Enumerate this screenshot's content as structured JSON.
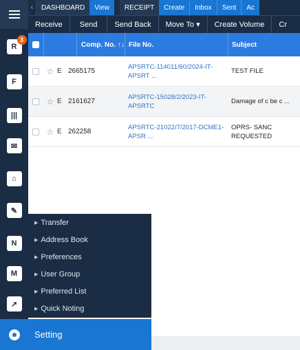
{
  "rail": {
    "badge_count": "3",
    "icons": [
      "hamburger-icon",
      "receipt-icon",
      "file-icon",
      "barcode-icon",
      "mail-tray-icon",
      "dispatch-icon",
      "note-icon",
      "user-mail-icon",
      "contacts-icon",
      "chart-pen-icon",
      "gear-icon"
    ]
  },
  "topbar": {
    "dashboard": "DASHBOARD",
    "view": "View",
    "receipt": "RECEIPT",
    "create": "Create",
    "inbox": "Inbox",
    "sent": "Sent",
    "more": "Ac"
  },
  "actions": [
    "Receive",
    "Send",
    "Send Back",
    "Move To ▾",
    "Create Volume",
    "Cr"
  ],
  "table": {
    "headers": {
      "comp_no": "Comp. No. ↑↓",
      "file_no": "File No.",
      "subject": "Subject"
    },
    "rows": [
      {
        "type": "E",
        "num": "2665175",
        "file": "APSRTC-114011/60/2024-IT-APSRT ...",
        "subject": "TEST FILE"
      },
      {
        "type": "E",
        "num": "2161627",
        "file": "APSRTC-15028/2/2023-IT-APSRTC",
        "subject": "Damage of c be c ..."
      },
      {
        "type": "E",
        "num": "262258",
        "file": "APSRTC-21022/7/2017-DCME1-APSR ...",
        "subject": "OPRS- SANC REQUESTED"
      }
    ]
  },
  "menu": {
    "items": [
      "Transfer",
      "Address Book",
      "Preferences",
      "User Group",
      "Preferred List",
      "Quick Noting"
    ],
    "setting": "Setting"
  }
}
